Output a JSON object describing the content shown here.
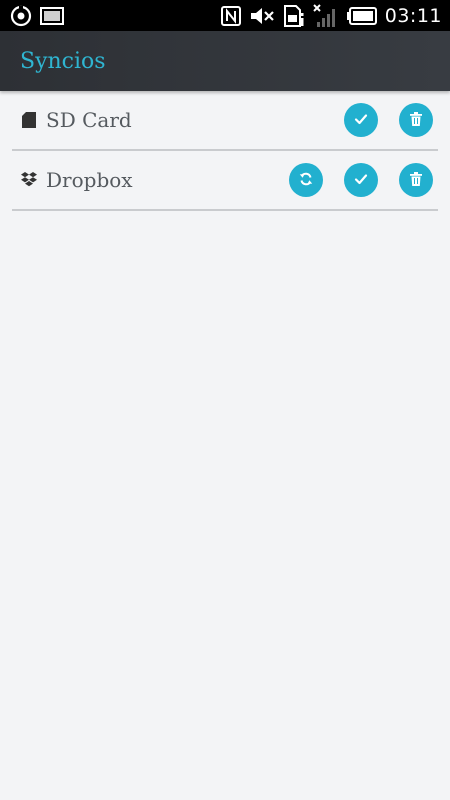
{
  "status_bar": {
    "time": "03:11",
    "icons": [
      "sync-circle-icon",
      "image-icon",
      "nfc-icon",
      "mute-icon",
      "sim-card-icon",
      "signal-off-icon",
      "battery-icon"
    ]
  },
  "app_bar": {
    "title": "Syncios"
  },
  "colors": {
    "accent": "#22b0cf",
    "title": "#2fb5d1",
    "app_bar": "#33363b",
    "background": "#f3f4f6"
  },
  "storage_items": [
    {
      "label": "SD Card",
      "icon": "sd-card-icon",
      "actions": [
        "check-icon",
        "trash-icon"
      ]
    },
    {
      "label": "Dropbox",
      "icon": "dropbox-icon",
      "actions": [
        "sync-icon",
        "check-icon",
        "trash-icon"
      ]
    }
  ]
}
